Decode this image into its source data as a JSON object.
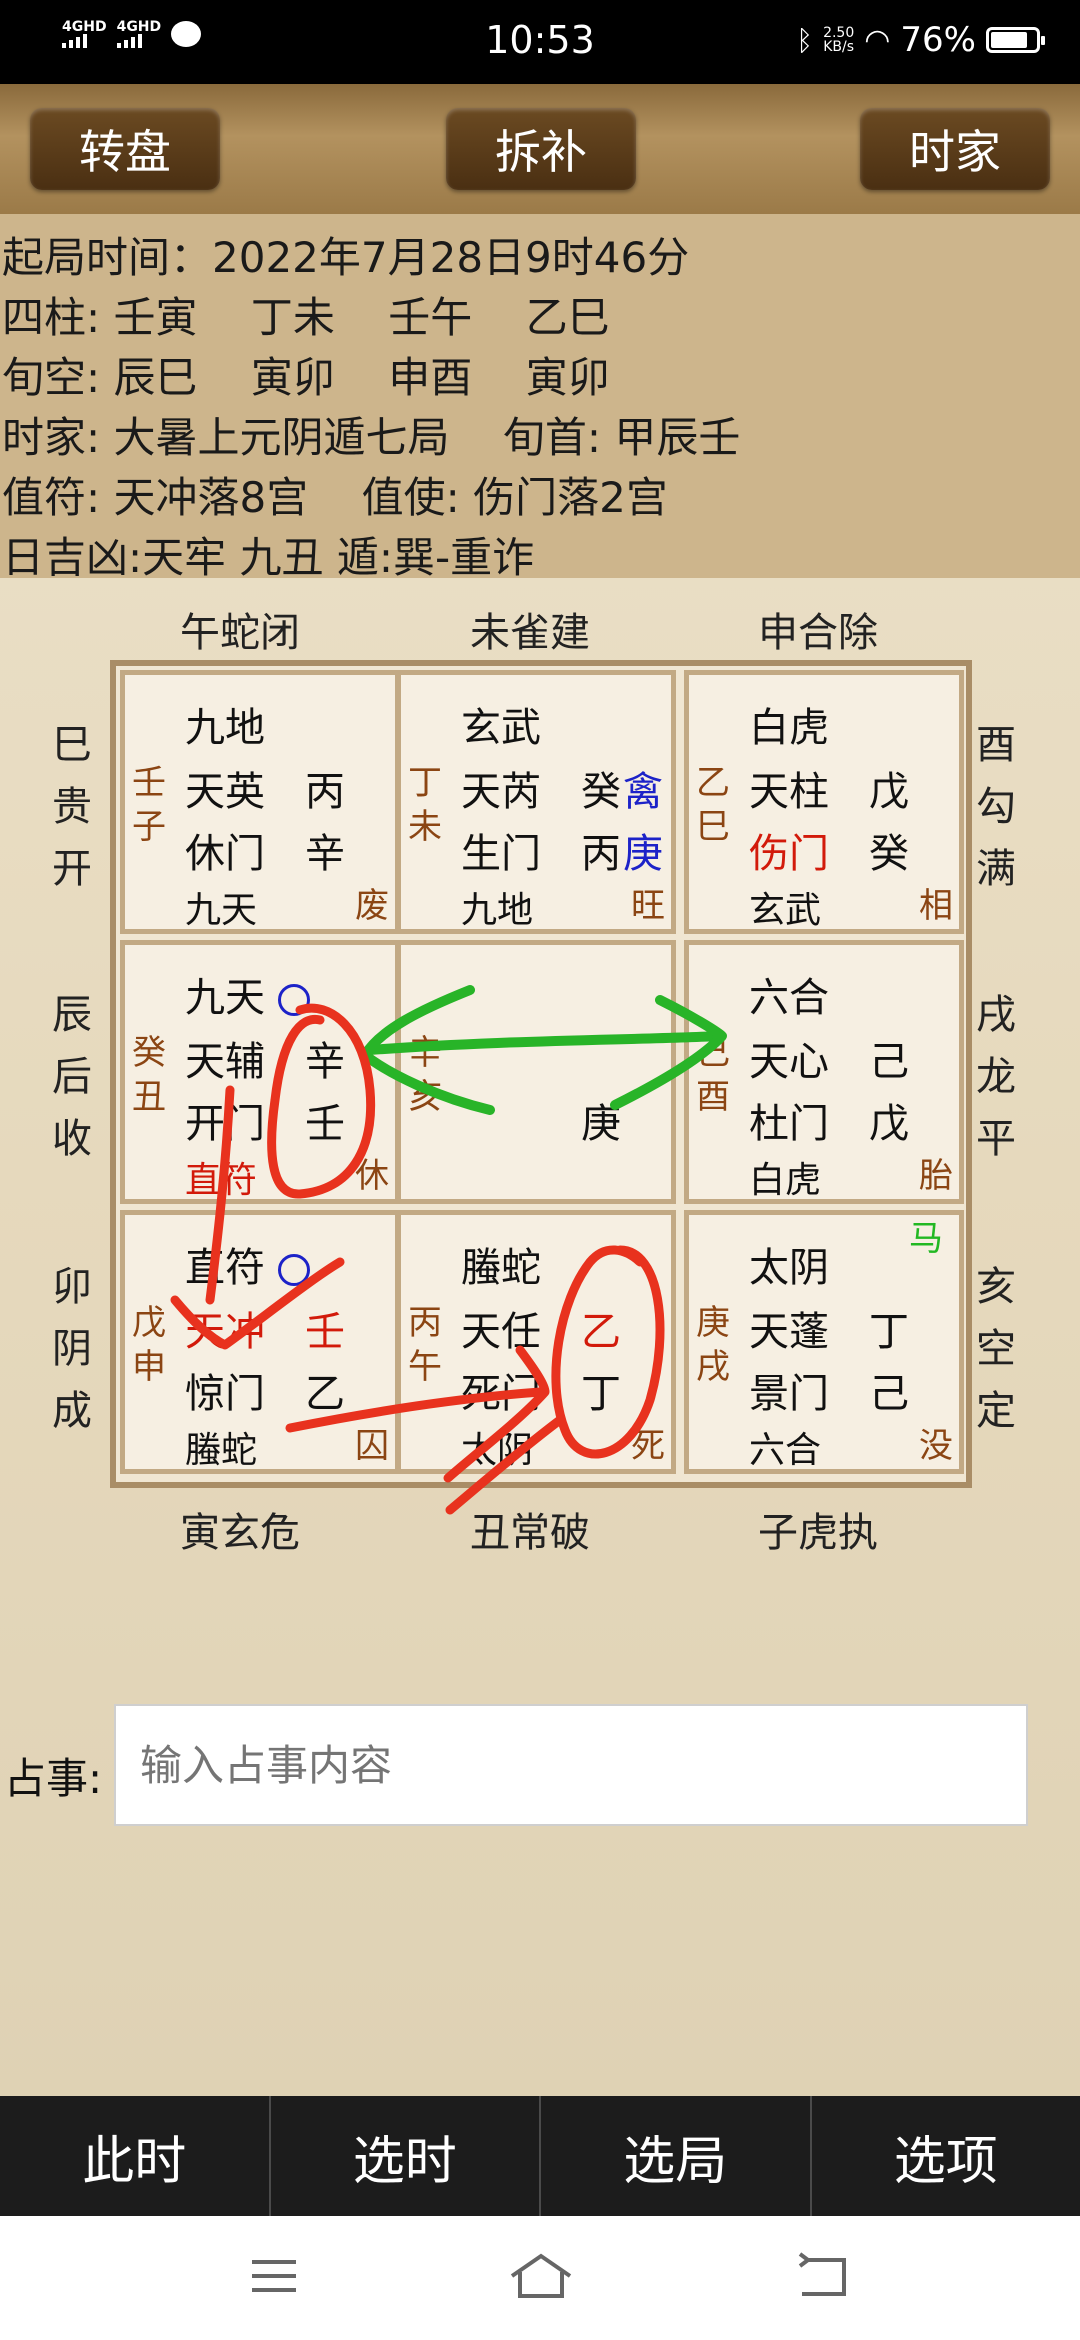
{
  "status": {
    "net1": "4GHD",
    "net2": "4GHD",
    "time": "10:53",
    "speed_top": "2.50",
    "speed_bottom": "KB/s",
    "battery": "76%"
  },
  "toolbar": {
    "left": "转盘",
    "center": "拆补",
    "right": "时家"
  },
  "info": [
    "起局时间：2022年7月28日9时46分",
    "四柱: 壬寅    丁未    壬午    乙巳",
    "旬空: 辰巳    寅卯    申酉    寅卯",
    "时家: 大暑上元阴遁七局    旬首: 甲辰壬",
    "值符: 天冲落8宫    值使: 伤门落2宫",
    "日吉凶:天牢 九丑 遁:巽-重诈"
  ],
  "top_labels": [
    "午蛇闭",
    "未雀建",
    "申合除"
  ],
  "bottom_labels": [
    "寅玄危",
    "丑常破",
    "子虎执"
  ],
  "left_labels": [
    "巳贵开",
    "辰后收",
    "卯阴成"
  ],
  "right_labels": [
    "酉勾满",
    "戌龙平",
    "亥空定"
  ],
  "cells": [
    {
      "side": "壬子",
      "l1": "九地",
      "l2a": "天英",
      "l2b": "丙",
      "l3a": "休门",
      "l3b": "辛",
      "l4": "九天",
      "corner": "废"
    },
    {
      "side": "丁未",
      "l1": "玄武",
      "l2a": "天芮",
      "l2b": "癸",
      "l2c": "禽",
      "l3a": "生门",
      "l3b": "丙",
      "l3c": "庚",
      "l4": "九地",
      "corner": "旺"
    },
    {
      "side": "乙巳",
      "l1": "白虎",
      "l2a": "天柱",
      "l2b": "戊",
      "l3a": "伤门",
      "l3b": "癸",
      "l4": "玄武",
      "corner": "相"
    },
    {
      "side": "癸丑",
      "l1": "九天",
      "l2a": "天辅",
      "l2b": "辛",
      "l3a": "开门",
      "l3b": "壬",
      "l4": "直符",
      "corner": "休"
    },
    {
      "side": "辛亥",
      "l1": "",
      "l2a": "",
      "l2b": "",
      "l3a": "",
      "l3b": "庚",
      "l4": "",
      "corner": ""
    },
    {
      "side": "己酉",
      "l1": "六合",
      "l2a": "天心",
      "l2b": "己",
      "l3a": "杜门",
      "l3b": "戊",
      "l4": "白虎",
      "corner": "胎"
    },
    {
      "side": "戊申",
      "l1": "直符",
      "l2a": "天冲",
      "l2b": "壬",
      "l3a": "惊门",
      "l3b": "乙",
      "l4": "螣蛇",
      "corner": "囚"
    },
    {
      "side": "丙午",
      "l1": "螣蛇",
      "l2a": "天任",
      "l2b": "乙",
      "l3a": "死门",
      "l3b": "丁",
      "l4": "太阴",
      "corner": "死"
    },
    {
      "side": "庚戌",
      "l1": "太阴",
      "l2a": "天蓬",
      "l2b": "丁",
      "l3a": "景门",
      "l3b": "己",
      "l4": "六合",
      "corner": "没",
      "extra": "马"
    }
  ],
  "input": {
    "label": "占事:",
    "placeholder": "输入占事内容"
  },
  "bottom_bar": [
    "此时",
    "选时",
    "选局",
    "选项"
  ],
  "colors": {
    "toolbar": "#9b7a48",
    "info_bg": "#cdb58c",
    "annotation_red": "#e8321e",
    "annotation_green": "#28b428"
  }
}
